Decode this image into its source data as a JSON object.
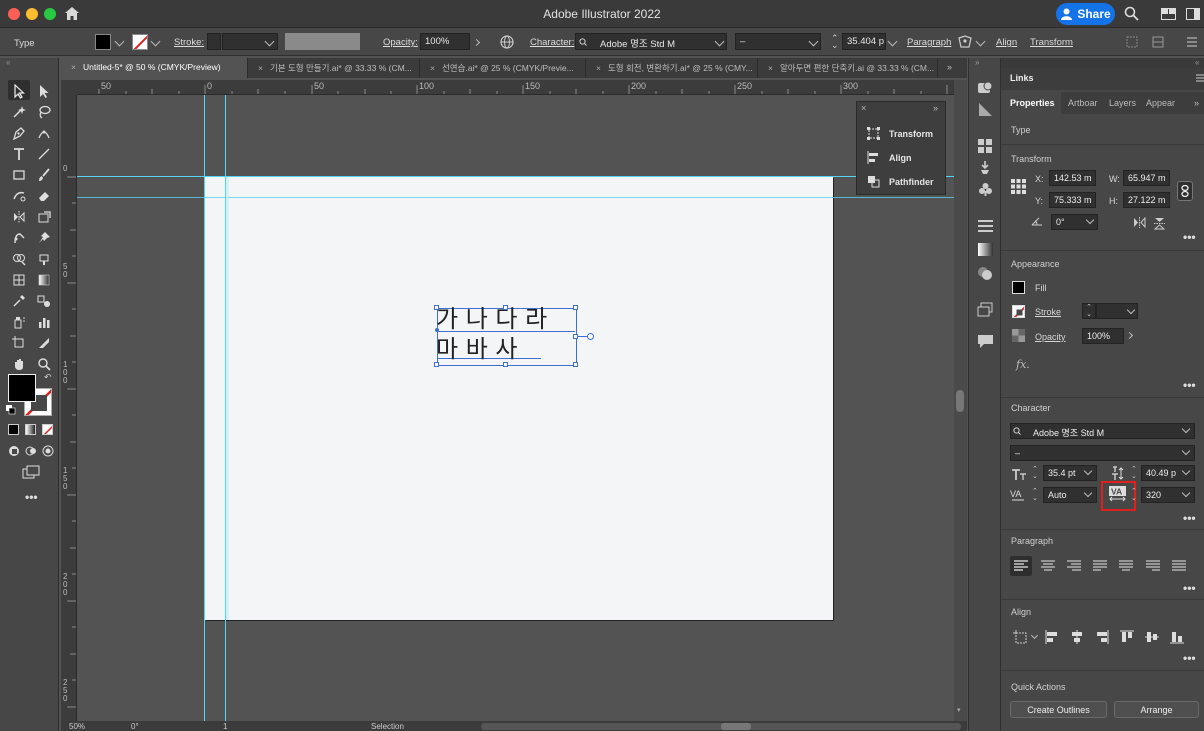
{
  "app": {
    "title": "Adobe Illustrator 2022",
    "share_label": "Share"
  },
  "control_bar": {
    "selection_type": "Type",
    "stroke_label": "Stroke:",
    "opacity_label": "Opacity:",
    "opacity_value": "100%",
    "character_label": "Character:",
    "font_name": "Adobe 명조 Std M",
    "font_style": "–",
    "font_size": "35.404 p",
    "paragraph_label": "Paragraph",
    "align_label": "Align",
    "transform_label": "Transform"
  },
  "tabs": [
    {
      "label": "Untitled-5* @ 50 % (CMYK/Preview)",
      "active": true
    },
    {
      "label": "기본 도형 만들기.ai* @ 33.33 % (CM...",
      "active": false
    },
    {
      "label": "선연습.ai* @ 25 % (CMYK/Previe...",
      "active": false
    },
    {
      "label": "도형 회전, 변환하기.ai* @ 25 % (CMY...",
      "active": false
    },
    {
      "label": "알아두면 편한 단축키.ai @ 33.33 % (CM...",
      "active": false
    }
  ],
  "ruler": {
    "h_ticks": [
      "50",
      "0",
      "50",
      "100",
      "150",
      "200",
      "250",
      "300"
    ],
    "v_ticks": [
      "0",
      "5 0",
      "1 0 0",
      "1 5 0",
      "2 0 0",
      "2 5 0"
    ]
  },
  "canvas_text": {
    "line1": "가 나 다 라",
    "line2": "마 바 사"
  },
  "float_panel": {
    "items": [
      "Transform",
      "Align",
      "Pathfinder"
    ]
  },
  "status_bar": {
    "zoom": "50%",
    "rotation": "0°",
    "artboard": "1",
    "tool": "Selection"
  },
  "panel": {
    "header": "Links",
    "tabs": [
      "Properties",
      "Artboar",
      "Layers",
      "Appear"
    ],
    "type_heading": "Type",
    "transform": {
      "heading": "Transform",
      "x_label": "X:",
      "x": "142.53 m",
      "y_label": "Y:",
      "y": "75.333 m",
      "w_label": "W:",
      "w": "65.947 m",
      "h_label": "H:",
      "h": "27.122 m",
      "rotation": "0°"
    },
    "appearance": {
      "heading": "Appearance",
      "fill_label": "Fill",
      "stroke_label": "Stroke",
      "opacity_label": "Opacity",
      "opacity_value": "100%",
      "fx_label": "fx."
    },
    "character": {
      "heading": "Character",
      "font_name": "Adobe 명조 Std M",
      "font_style": "–",
      "font_size": "35.4 pt",
      "leading": "40.49 p",
      "kerning": "Auto",
      "tracking": "320"
    },
    "paragraph_heading": "Paragraph",
    "align_heading": "Align",
    "quick_actions": {
      "heading": "Quick Actions",
      "create_outlines": "Create Outlines",
      "arrange": "Arrange"
    }
  },
  "colors": {
    "accent": "#1473e6",
    "guide": "#54d3f3",
    "highlight_box": "#e0201b",
    "selection": "#3d6fd6"
  }
}
